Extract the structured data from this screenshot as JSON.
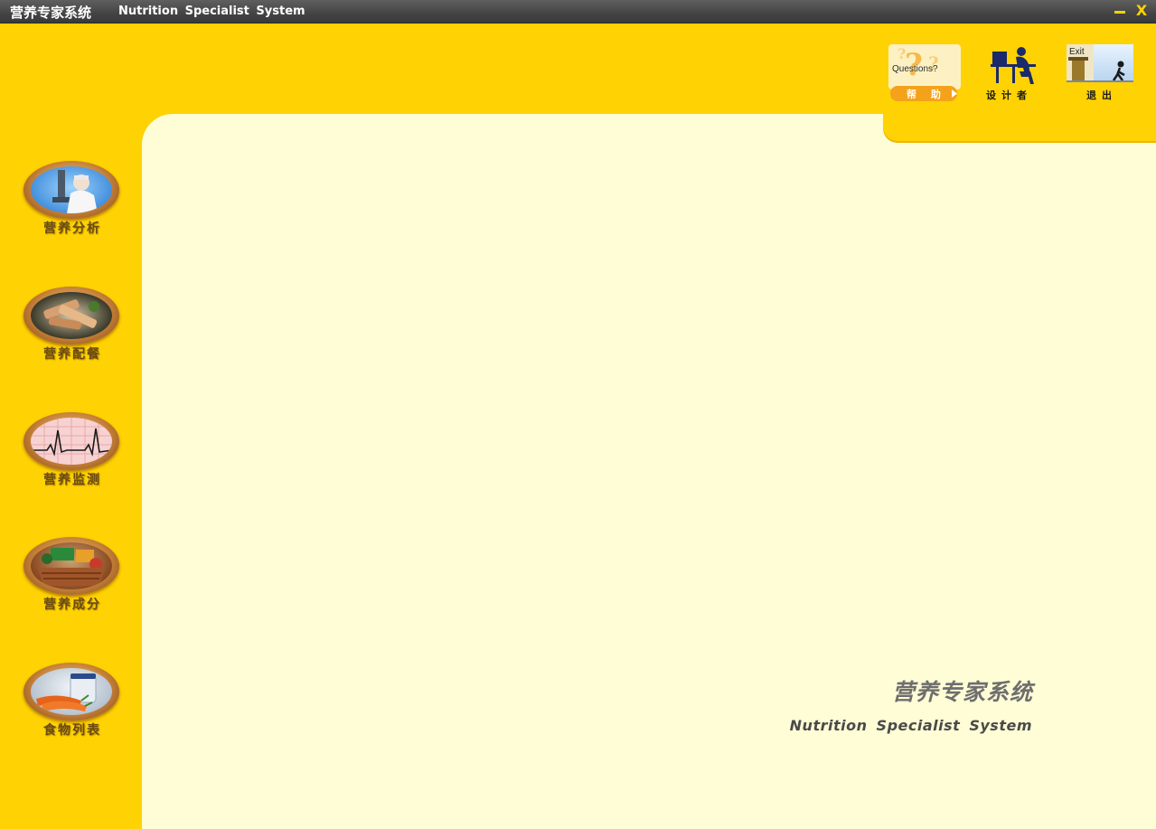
{
  "window": {
    "title_cn": "营养专家系统",
    "title_en": "Nutrition Specialist System",
    "minimize_icon": "minimize-icon",
    "close_glyph": "X"
  },
  "toolbar": {
    "help": {
      "image_text": "Questions?",
      "label": "帮 助",
      "icon": "help-question-icon"
    },
    "designer": {
      "label": "设计者",
      "icon": "designer-computer-icon"
    },
    "exit": {
      "image_text": "Exit",
      "label": "退出",
      "icon": "exit-door-icon"
    }
  },
  "sidebar": {
    "items": [
      {
        "label": "营养分析",
        "icon": "scientist-microscope-icon"
      },
      {
        "label": "营养配餐",
        "icon": "meal-plate-icon"
      },
      {
        "label": "营养监测",
        "icon": "heartbeat-monitor-icon"
      },
      {
        "label": "营养成分",
        "icon": "food-basket-icon"
      },
      {
        "label": "食物列表",
        "icon": "carrots-jar-icon"
      }
    ]
  },
  "branding": {
    "name_cn": "营养专家系统",
    "name_en": "Nutrition Specialist System"
  },
  "colors": {
    "background": "#FFD203",
    "panel": "#FFFDD6",
    "titlebar": "#444444",
    "accent": "#FFD203"
  }
}
